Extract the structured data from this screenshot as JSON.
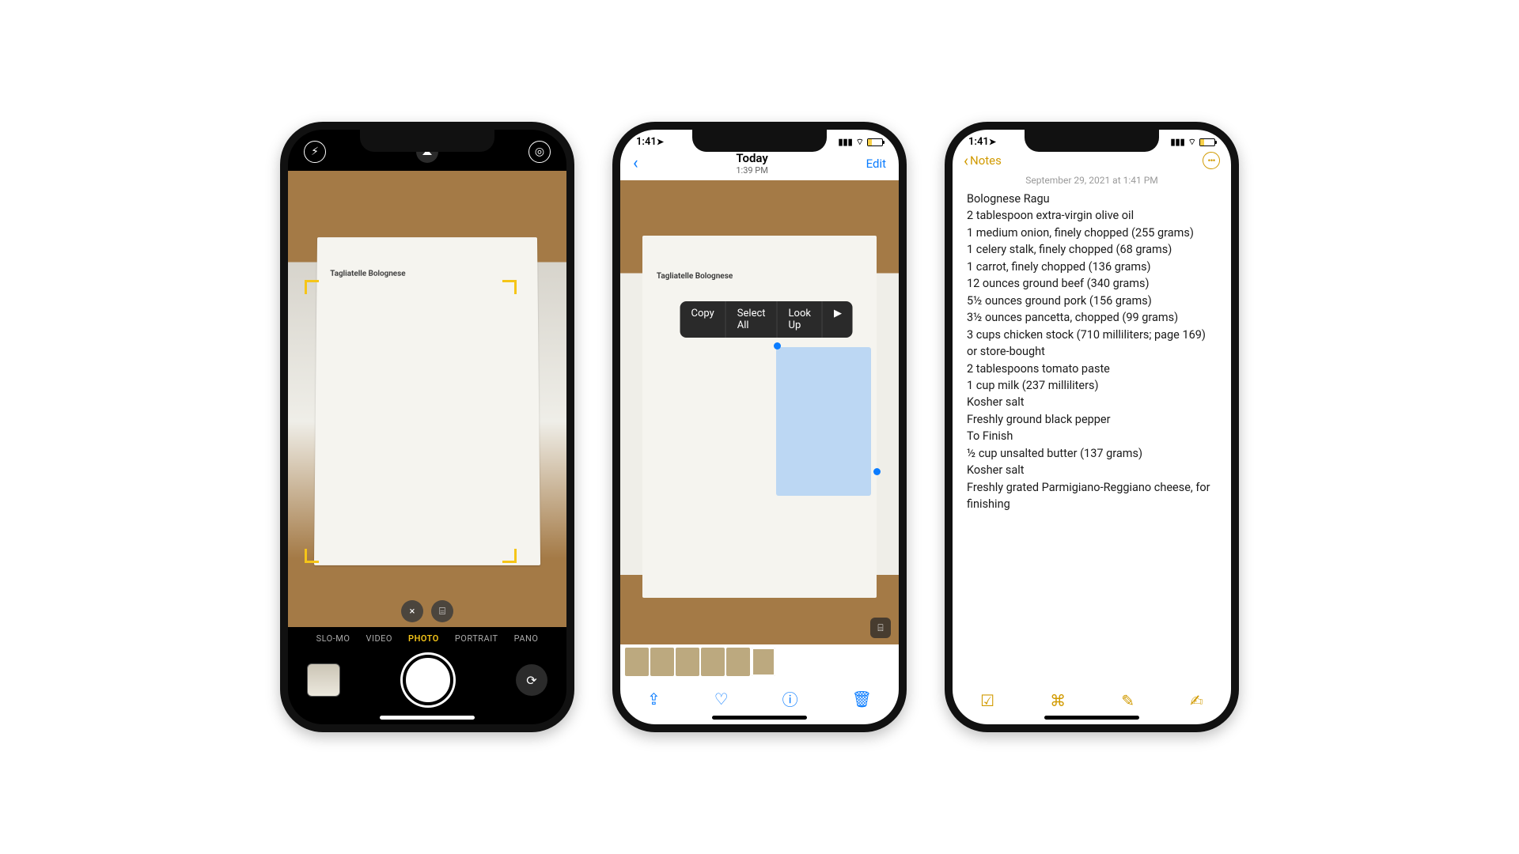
{
  "phone1": {
    "recipe_title": "Tagliatelle Bolognese",
    "close_glyph": "×",
    "modes": {
      "slomo": "SLO-MO",
      "video": "VIDEO",
      "photo": "PHOTO",
      "portrait": "PORTRAIT",
      "pano": "PANO"
    }
  },
  "phone2": {
    "status_time": "1:41",
    "nav_title": "Today",
    "nav_subtitle": "1:39 PM",
    "edit_label": "Edit",
    "recipe_title": "Tagliatelle Bolognese",
    "menu": {
      "copy": "Copy",
      "select_all": "Select All",
      "look_up": "Look Up",
      "more": "▶"
    }
  },
  "phone3": {
    "status_time": "1:41",
    "back_label": "Notes",
    "date_label": "September 29, 2021 at 1:41 PM",
    "lines": [
      "Bolognese Ragu",
      "2 tablespoon extra-virgin olive oil",
      "1 medium onion, finely chopped (255 grams)",
      "1 celery stalk, finely chopped (68 grams)",
      "1 carrot, finely chopped (136 grams)",
      "12 ounces ground beef (340 grams)",
      "5½ ounces ground pork (156 grams)",
      "3½ ounces pancetta, chopped (99 grams)",
      "3 cups chicken stock (710 milliliters; page 169) or store-bought",
      "2 tablespoons tomato paste",
      "1 cup milk (237 milliliters)",
      "Kosher salt",
      "Freshly ground black pepper",
      "To Finish",
      "½ cup unsalted butter (137 grams)",
      "Kosher salt",
      "Freshly grated Parmigiano-Reggiano cheese, for finishing"
    ]
  }
}
